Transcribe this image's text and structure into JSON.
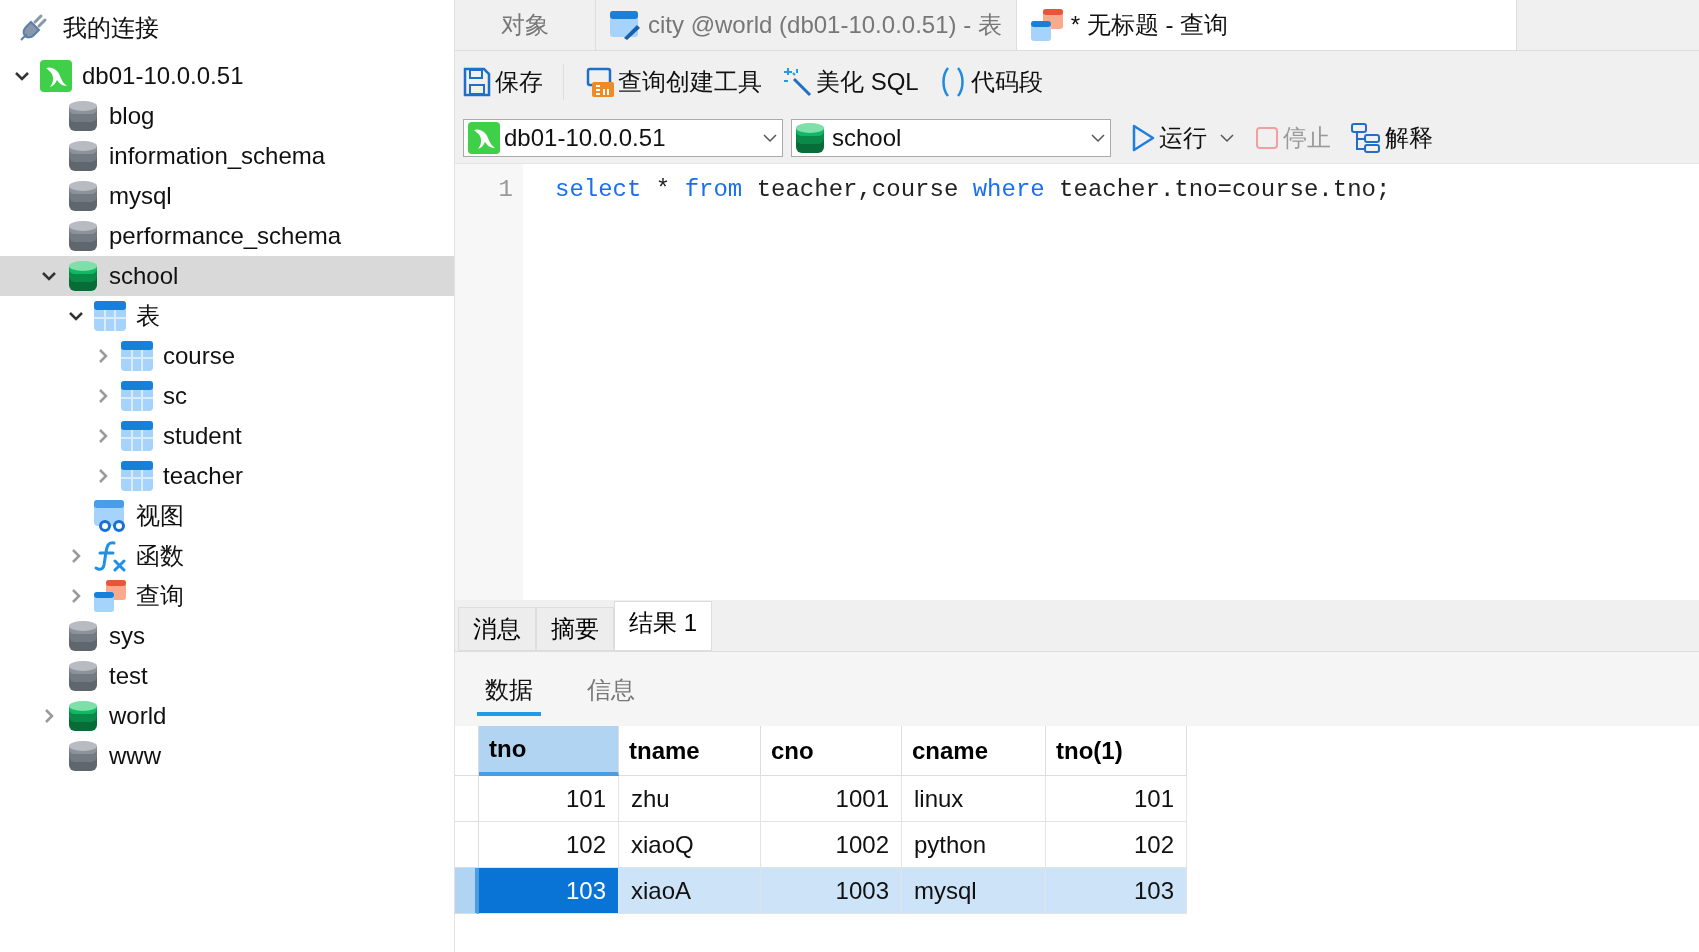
{
  "sidebar": {
    "title": "我的连接",
    "tree": [
      {
        "label": "db01-10.0.0.51",
        "kind": "connection",
        "expanded": true,
        "selected": false,
        "children": [
          {
            "label": "blog",
            "kind": "database",
            "active": false,
            "selected": false
          },
          {
            "label": "information_schema",
            "kind": "database",
            "active": false,
            "selected": false
          },
          {
            "label": "mysql",
            "kind": "database",
            "active": false,
            "selected": false
          },
          {
            "label": "performance_schema",
            "kind": "database",
            "active": false,
            "selected": false
          },
          {
            "label": "school",
            "kind": "database",
            "active": true,
            "expanded": true,
            "selected": true,
            "children": [
              {
                "label": "表",
                "kind": "tables",
                "expanded": true,
                "selected": false,
                "children": [
                  {
                    "label": "course",
                    "kind": "table",
                    "expanded": false,
                    "selected": false
                  },
                  {
                    "label": "sc",
                    "kind": "table",
                    "expanded": false,
                    "selected": false
                  },
                  {
                    "label": "student",
                    "kind": "table",
                    "expanded": false,
                    "selected": false
                  },
                  {
                    "label": "teacher",
                    "kind": "table",
                    "expanded": false,
                    "selected": false
                  }
                ]
              },
              {
                "label": "视图",
                "kind": "views",
                "selected": false
              },
              {
                "label": "函数",
                "kind": "functions",
                "expanded": false,
                "selected": false
              },
              {
                "label": "查询",
                "kind": "queries",
                "expanded": false,
                "selected": false
              }
            ]
          },
          {
            "label": "sys",
            "kind": "database",
            "active": false,
            "selected": false
          },
          {
            "label": "test",
            "kind": "database",
            "active": false,
            "selected": false
          },
          {
            "label": "world",
            "kind": "database",
            "active": true,
            "expanded": false,
            "selected": false
          },
          {
            "label": "www",
            "kind": "database",
            "active": false,
            "selected": false
          }
        ]
      }
    ]
  },
  "tabs": [
    {
      "label": "对象",
      "kind": "objects",
      "selected": false
    },
    {
      "label": "city @world (db01-10.0.0.51) - 表",
      "kind": "table",
      "selected": false
    },
    {
      "label": "* 无标题 - 查询",
      "kind": "query",
      "selected": true
    }
  ],
  "toolbar": [
    {
      "label": "保存",
      "kind": "save"
    },
    {
      "label": "查询创建工具",
      "kind": "builder"
    },
    {
      "label": "美化 SQL",
      "kind": "beautify"
    },
    {
      "label": "代码段",
      "kind": "snippet"
    }
  ],
  "connection_select": {
    "value": "db01-10.0.0.51"
  },
  "database_select": {
    "value": "school"
  },
  "actions": [
    {
      "label": "运行",
      "kind": "run",
      "disabled": false
    },
    {
      "label": "停止",
      "kind": "stop",
      "disabled": true
    },
    {
      "label": "解释",
      "kind": "explain",
      "disabled": false
    }
  ],
  "editor": {
    "lines": [
      {
        "number": "1",
        "tokens": [
          {
            "text": "select",
            "kind": "keyword"
          },
          {
            "text": " * ",
            "kind": "plain"
          },
          {
            "text": "from",
            "kind": "keyword"
          },
          {
            "text": " teacher,course ",
            "kind": "plain"
          },
          {
            "text": "where",
            "kind": "keyword"
          },
          {
            "text": " teacher.tno=course.tno;",
            "kind": "plain"
          }
        ]
      }
    ]
  },
  "result_tabs": [
    {
      "label": "消息",
      "selected": false
    },
    {
      "label": "摘要",
      "selected": false
    },
    {
      "label": "结果 1",
      "selected": true
    }
  ],
  "result_subtabs": [
    {
      "label": "数据",
      "selected": true
    },
    {
      "label": "信息",
      "selected": false
    }
  ],
  "table": {
    "columns": [
      {
        "label": "tno",
        "kind": "number",
        "selected": true
      },
      {
        "label": "tname",
        "kind": "text",
        "selected": false
      },
      {
        "label": "cno",
        "kind": "number",
        "selected": false
      },
      {
        "label": "cname",
        "kind": "text",
        "selected": false
      },
      {
        "label": "tno(1)",
        "kind": "number",
        "selected": false
      }
    ],
    "rows": [
      {
        "cells": [
          "101",
          "zhu",
          "1001",
          "linux",
          "101"
        ],
        "selected": false
      },
      {
        "cells": [
          "102",
          "xiaoQ",
          "1002",
          "python",
          "102"
        ],
        "selected": false
      },
      {
        "cells": [
          "103",
          "xiaoA",
          "1003",
          "mysql",
          "103"
        ],
        "selected": true
      }
    ]
  }
}
